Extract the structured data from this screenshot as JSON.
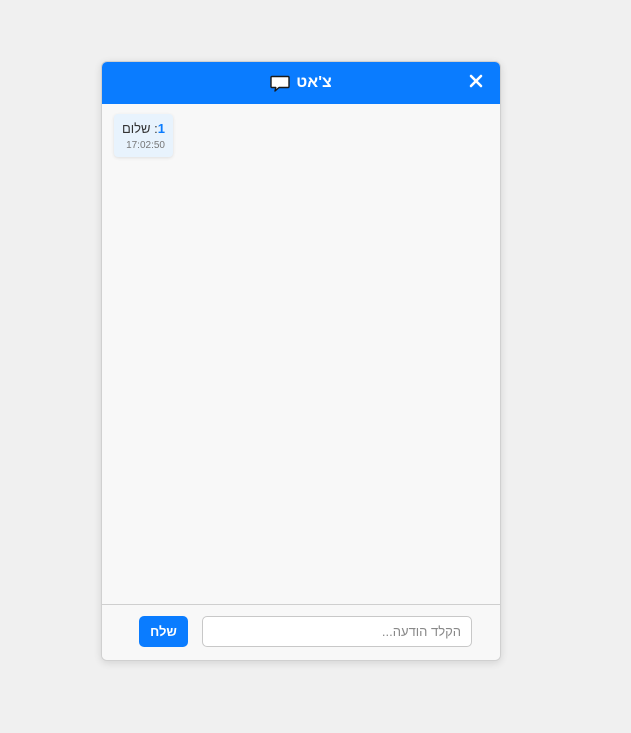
{
  "header": {
    "title": "צ'אט",
    "icon": "speech-bubble-icon",
    "close_icon": "close-icon",
    "background_color": "#0a7cff"
  },
  "messages": [
    {
      "sender": "1",
      "text": "שלום",
      "time": "17:02:50"
    }
  ],
  "footer": {
    "input_value": "",
    "input_placeholder": "הקלד הודעה...",
    "send_label": "שלח"
  }
}
